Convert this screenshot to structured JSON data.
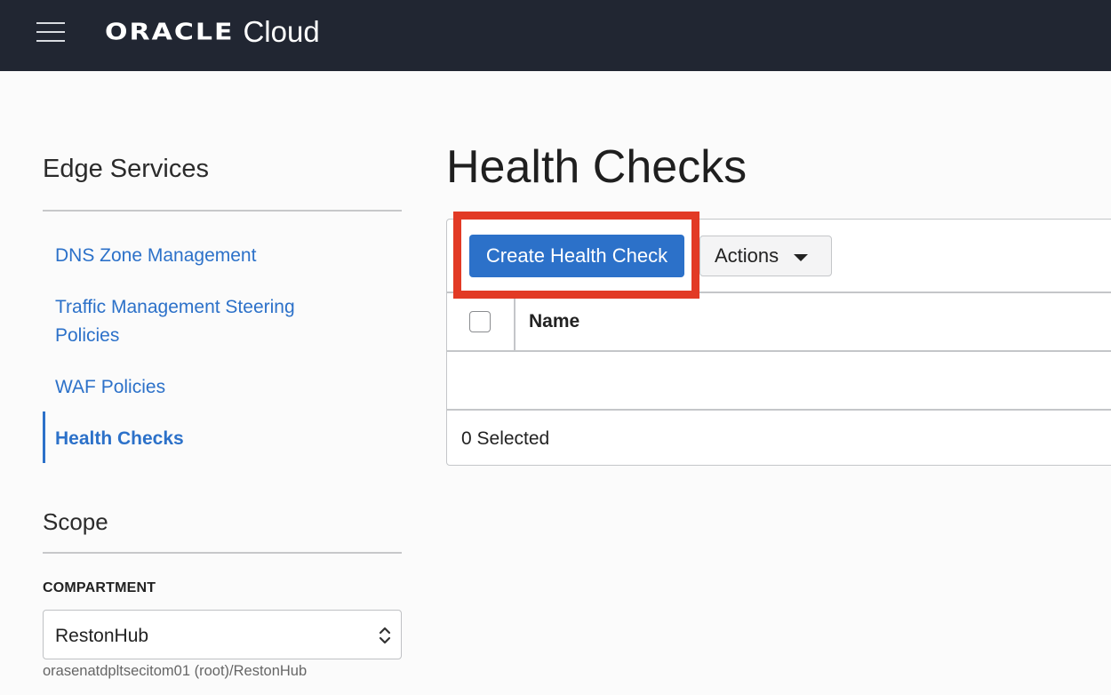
{
  "header": {
    "logo_brand": "ORACLE",
    "logo_product": "Cloud",
    "menu_icon": "hamburger-icon"
  },
  "sidebar": {
    "title": "Edge Services",
    "items": [
      {
        "label": "DNS Zone Management"
      },
      {
        "label": "Traffic Management Steering Policies"
      },
      {
        "label": "WAF Policies"
      },
      {
        "label": "Health Checks",
        "active": true
      }
    ],
    "scope": {
      "title": "Scope",
      "compartment_label": "COMPARTMENT",
      "compartment_value": "RestonHub",
      "compartment_path": "orasenatdpltsecitom01 (root)/RestonHub"
    }
  },
  "main": {
    "title": "Health Checks",
    "create_button": "Create Health Check",
    "actions_button": "Actions",
    "table": {
      "columns": [
        "Name"
      ],
      "rows": []
    },
    "selected_count": "0 Selected"
  },
  "colors": {
    "topbar": "#212632",
    "accent": "#2c71c9",
    "highlight": "#e23a25"
  }
}
